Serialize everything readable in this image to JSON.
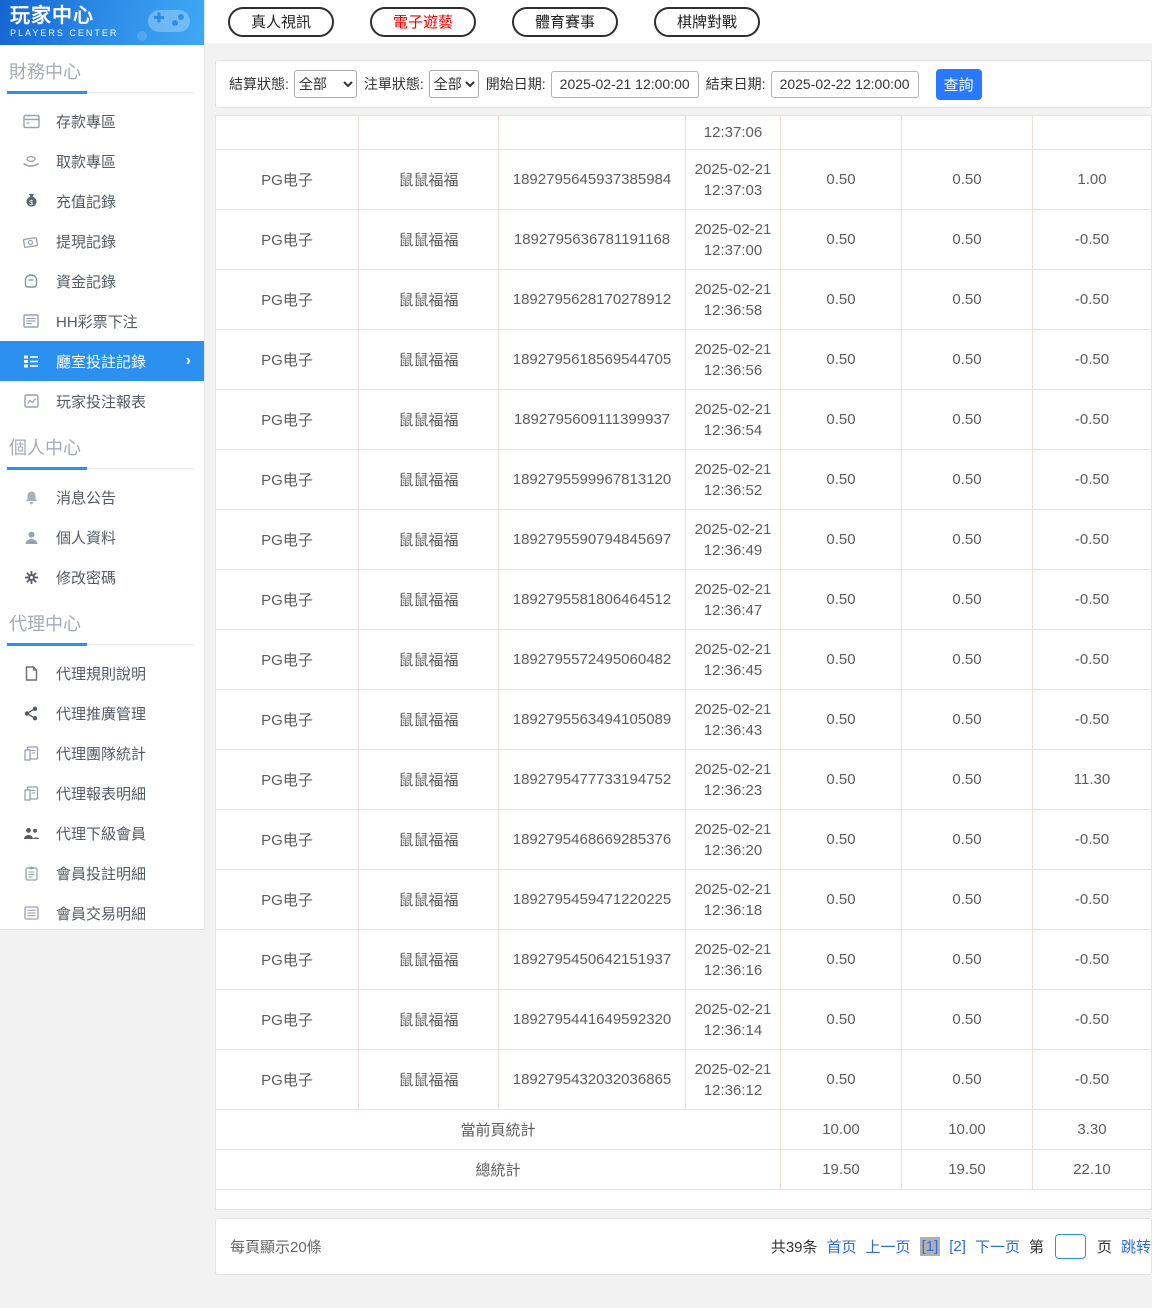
{
  "app": {
    "title": "玩家中心",
    "subtitle": "PLAYERS CENTER"
  },
  "sidebar": {
    "sections": [
      {
        "title": "財務中心",
        "items": [
          {
            "label": "存款專區",
            "icon": "deposit-card-icon"
          },
          {
            "label": "取款專區",
            "icon": "withdraw-hand-icon"
          },
          {
            "label": "充值記錄",
            "icon": "money-bag-icon"
          },
          {
            "label": "提現記錄",
            "icon": "banknotes-icon"
          },
          {
            "label": "資金記錄",
            "icon": "purse-icon"
          },
          {
            "label": "HH彩票下注",
            "icon": "lottery-list-icon"
          },
          {
            "label": "廳室投註記錄",
            "icon": "org-list-icon",
            "active": true
          },
          {
            "label": "玩家投注報表",
            "icon": "chart-box-icon"
          }
        ]
      },
      {
        "title": "個人中心",
        "items": [
          {
            "label": "消息公告",
            "icon": "bell-icon"
          },
          {
            "label": "個人資料",
            "icon": "user-icon"
          },
          {
            "label": "修改密碼",
            "icon": "gear-icon"
          }
        ]
      },
      {
        "title": "代理中心",
        "items": [
          {
            "label": "代理規則說明",
            "icon": "document-icon"
          },
          {
            "label": "代理推廣管理",
            "icon": "share-icon"
          },
          {
            "label": "代理團隊統計",
            "icon": "report-icon"
          },
          {
            "label": "代理報表明細",
            "icon": "report-icon"
          },
          {
            "label": "代理下級會員",
            "icon": "users-icon"
          },
          {
            "label": "會員投註明細",
            "icon": "clipboard-icon"
          },
          {
            "label": "會員交易明細",
            "icon": "list-box-icon"
          }
        ]
      }
    ]
  },
  "tabs": [
    {
      "label": "真人視訊",
      "active": false
    },
    {
      "label": "電子遊藝",
      "active": true
    },
    {
      "label": "體育賽事",
      "active": false
    },
    {
      "label": "棋牌對戰",
      "active": false
    }
  ],
  "filters": {
    "settle_label": "結算狀態:",
    "settle_value": "全部",
    "order_label": "注單狀態:",
    "order_value": "全部",
    "start_label": "開始日期:",
    "start_value": "2025-02-21 12:00:00",
    "end_label": "結束日期:",
    "end_value": "2025-02-22 12:00:00",
    "query_label": "查詢"
  },
  "table": {
    "partial_row_time": "12:37:06",
    "rows": [
      {
        "platform": "PG电子",
        "game": "鼠鼠福福",
        "bet_id": "1892795645937385984",
        "date": "2025-02-21",
        "time": "12:37:03",
        "bet": "0.50",
        "valid": "0.50",
        "result": "1.00"
      },
      {
        "platform": "PG电子",
        "game": "鼠鼠福福",
        "bet_id": "1892795636781191168",
        "date": "2025-02-21",
        "time": "12:37:00",
        "bet": "0.50",
        "valid": "0.50",
        "result": "-0.50"
      },
      {
        "platform": "PG电子",
        "game": "鼠鼠福福",
        "bet_id": "1892795628170278912",
        "date": "2025-02-21",
        "time": "12:36:58",
        "bet": "0.50",
        "valid": "0.50",
        "result": "-0.50"
      },
      {
        "platform": "PG电子",
        "game": "鼠鼠福福",
        "bet_id": "1892795618569544705",
        "date": "2025-02-21",
        "time": "12:36:56",
        "bet": "0.50",
        "valid": "0.50",
        "result": "-0.50"
      },
      {
        "platform": "PG电子",
        "game": "鼠鼠福福",
        "bet_id": "1892795609111399937",
        "date": "2025-02-21",
        "time": "12:36:54",
        "bet": "0.50",
        "valid": "0.50",
        "result": "-0.50"
      },
      {
        "platform": "PG电子",
        "game": "鼠鼠福福",
        "bet_id": "1892795599967813120",
        "date": "2025-02-21",
        "time": "12:36:52",
        "bet": "0.50",
        "valid": "0.50",
        "result": "-0.50"
      },
      {
        "platform": "PG电子",
        "game": "鼠鼠福福",
        "bet_id": "1892795590794845697",
        "date": "2025-02-21",
        "time": "12:36:49",
        "bet": "0.50",
        "valid": "0.50",
        "result": "-0.50"
      },
      {
        "platform": "PG电子",
        "game": "鼠鼠福福",
        "bet_id": "1892795581806464512",
        "date": "2025-02-21",
        "time": "12:36:47",
        "bet": "0.50",
        "valid": "0.50",
        "result": "-0.50"
      },
      {
        "platform": "PG电子",
        "game": "鼠鼠福福",
        "bet_id": "1892795572495060482",
        "date": "2025-02-21",
        "time": "12:36:45",
        "bet": "0.50",
        "valid": "0.50",
        "result": "-0.50"
      },
      {
        "platform": "PG电子",
        "game": "鼠鼠福福",
        "bet_id": "1892795563494105089",
        "date": "2025-02-21",
        "time": "12:36:43",
        "bet": "0.50",
        "valid": "0.50",
        "result": "-0.50"
      },
      {
        "platform": "PG电子",
        "game": "鼠鼠福福",
        "bet_id": "1892795477733194752",
        "date": "2025-02-21",
        "time": "12:36:23",
        "bet": "0.50",
        "valid": "0.50",
        "result": "11.30"
      },
      {
        "platform": "PG电子",
        "game": "鼠鼠福福",
        "bet_id": "1892795468669285376",
        "date": "2025-02-21",
        "time": "12:36:20",
        "bet": "0.50",
        "valid": "0.50",
        "result": "-0.50"
      },
      {
        "platform": "PG电子",
        "game": "鼠鼠福福",
        "bet_id": "1892795459471220225",
        "date": "2025-02-21",
        "time": "12:36:18",
        "bet": "0.50",
        "valid": "0.50",
        "result": "-0.50"
      },
      {
        "platform": "PG电子",
        "game": "鼠鼠福福",
        "bet_id": "1892795450642151937",
        "date": "2025-02-21",
        "time": "12:36:16",
        "bet": "0.50",
        "valid": "0.50",
        "result": "-0.50"
      },
      {
        "platform": "PG电子",
        "game": "鼠鼠福福",
        "bet_id": "1892795441649592320",
        "date": "2025-02-21",
        "time": "12:36:14",
        "bet": "0.50",
        "valid": "0.50",
        "result": "-0.50"
      },
      {
        "platform": "PG电子",
        "game": "鼠鼠福福",
        "bet_id": "1892795432032036865",
        "date": "2025-02-21",
        "time": "12:36:12",
        "bet": "0.50",
        "valid": "0.50",
        "result": "-0.50"
      }
    ],
    "summary": [
      {
        "label": "當前頁統計",
        "bet": "10.00",
        "valid": "10.00",
        "result": "3.30"
      },
      {
        "label": "總統計",
        "bet": "19.50",
        "valid": "19.50",
        "result": "22.10"
      }
    ]
  },
  "pagination": {
    "page_size_text": "每頁顯示20條",
    "total_text": "共39条",
    "first": "首页",
    "prev": "上一页",
    "pages": [
      "[1]",
      "[2]"
    ],
    "next": "下一页",
    "jump_prefix": "第",
    "jump_suffix": "页",
    "jump_label": "跳转"
  },
  "colors": {
    "accent_blue": "#2b90f0",
    "button_blue": "#2979ff",
    "active_tab_red": "#f20000",
    "table_border_pink": "#f3dbdb",
    "link_blue": "#2d6cdb",
    "current_page_bg": "#b0b0b0"
  }
}
